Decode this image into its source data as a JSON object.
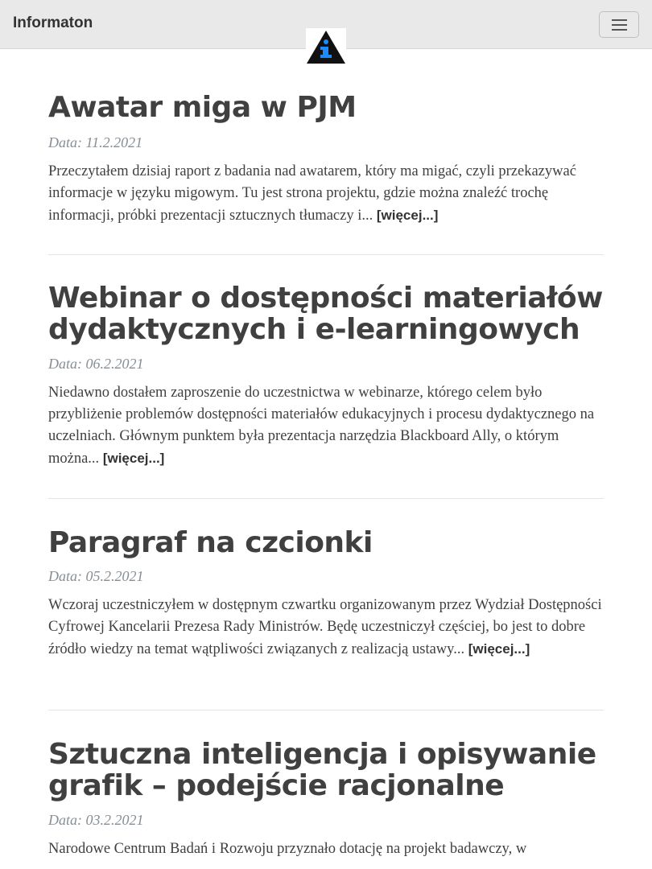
{
  "navbar": {
    "brand": "Informaton",
    "menu_icon": "hamburger-menu-icon"
  },
  "logo": {
    "icon": "info-triangle-logo",
    "colors": {
      "triangle": "#111111",
      "letter": "#1a8cff"
    }
  },
  "posts": [
    {
      "title": "Awatar miga w PJM",
      "date_label": "Data: 11.2.2021",
      "excerpt": "Przeczytałem dzisiaj raport z badania nad awatarem, który ma migać, czyli przekazywać informacje w języku migowym. Tu jest strona projektu, gdzie można znaleźć trochę informacji, próbki prezentacji sztucznych tłumaczy i...",
      "more": "[więcej...]"
    },
    {
      "title": "Webinar o dostępności materiałów dydaktycznych i e-learningowych",
      "date_label": "Data: 06.2.2021",
      "excerpt": "Niedawno dostałem zaproszenie do uczestnictwa w webinarze, którego celem było przybliżenie problemów dostępności materiałów edukacyjnych i procesu dydaktycznego na uczelniach. Głównym punktem była prezentacja narzędzia Blackboard Ally, o którym można...",
      "more": "[więcej...]"
    },
    {
      "title": "Paragraf na czcionki",
      "date_label": "Data: 05.2.2021",
      "excerpt": "Wczoraj uczestniczyłem w dostępnym czwartku organizowanym przez Wydział Dostępności Cyfrowej Kancelarii Prezesa Rady Ministrów. Będę uczestniczył częściej, bo jest to dobre źródło wiedzy na temat wątpliwości związanych z realizacją ustawy...",
      "more": "[więcej...]"
    },
    {
      "title": "Sztuczna inteligencja i opisywanie grafik – podejście racjonalne",
      "date_label": "Data: 03.2.2021",
      "excerpt": "Narodowe Centrum Badań i Rozwoju przyznało dotację na projekt badawczy, w",
      "more": ""
    }
  ]
}
